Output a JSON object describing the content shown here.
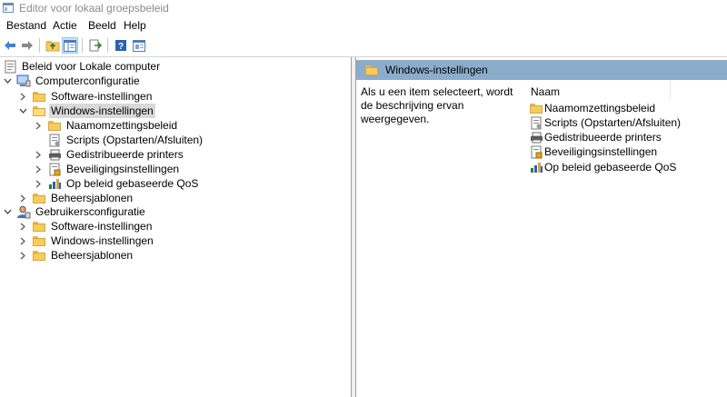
{
  "window": {
    "title": "Editor voor lokaal groepsbeleid"
  },
  "menu": [
    "Bestand",
    "Actie",
    "Beeld",
    "Help"
  ],
  "toolbar": {
    "buttons": [
      "back-icon",
      "forward-icon",
      "up-folder-icon",
      "show-hide-tree-icon",
      "export-list-icon",
      "help-icon",
      "properties-icon"
    ]
  },
  "tree": {
    "root": "Beleid voor Lokale computer",
    "computer": {
      "label": "Computerconfiguratie",
      "software": "Software-instellingen",
      "windows": {
        "label": "Windows-instellingen",
        "children": [
          "Naamomzettingsbeleid",
          "Scripts (Opstarten/Afsluiten)",
          "Gedistribueerde printers",
          "Beveiligingsinstellingen",
          "Op beleid gebaseerde QoS"
        ]
      },
      "templates": "Beheersjablonen"
    },
    "user": {
      "label": "Gebruikersconfiguratie",
      "software": "Software-instellingen",
      "windows": "Windows-instellingen",
      "templates": "Beheersjablonen"
    }
  },
  "details": {
    "header": "Windows-instellingen",
    "description": "Als u een item selecteert, wordt de beschrijving ervan weergegeven.",
    "column": "Naam",
    "items": [
      "Naamomzettingsbeleid",
      "Scripts (Opstarten/Afsluiten)",
      "Gedistribueerde printers",
      "Beveiligingsinstellingen",
      "Op beleid gebaseerde QoS"
    ]
  },
  "colors": {
    "header_bar": "#8bacca",
    "selection": "#d9d9d9",
    "folder": "#f6cd5c",
    "toolbar_active": "#cce4f7"
  }
}
